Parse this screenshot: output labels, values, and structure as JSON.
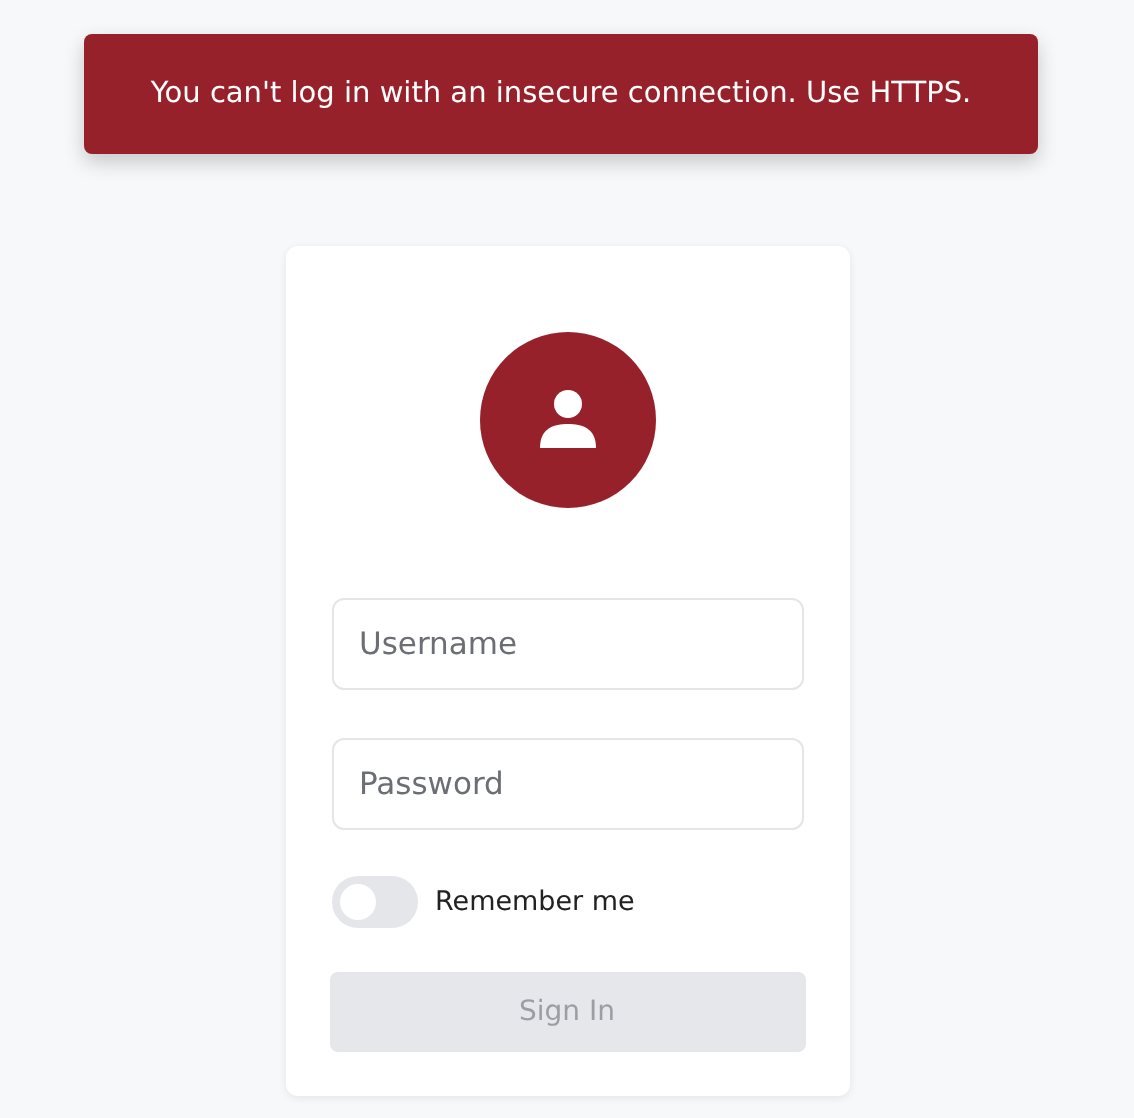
{
  "toast": {
    "message": "You can't log in with an insecure connection. Use HTTPS."
  },
  "fields": [
    {
      "placeholder": "Username"
    },
    {
      "placeholder": "Password"
    }
  ],
  "remember": {
    "label": "Remember me",
    "on": false
  },
  "sign_in": {
    "label": "Sign In",
    "disabled": true
  }
}
